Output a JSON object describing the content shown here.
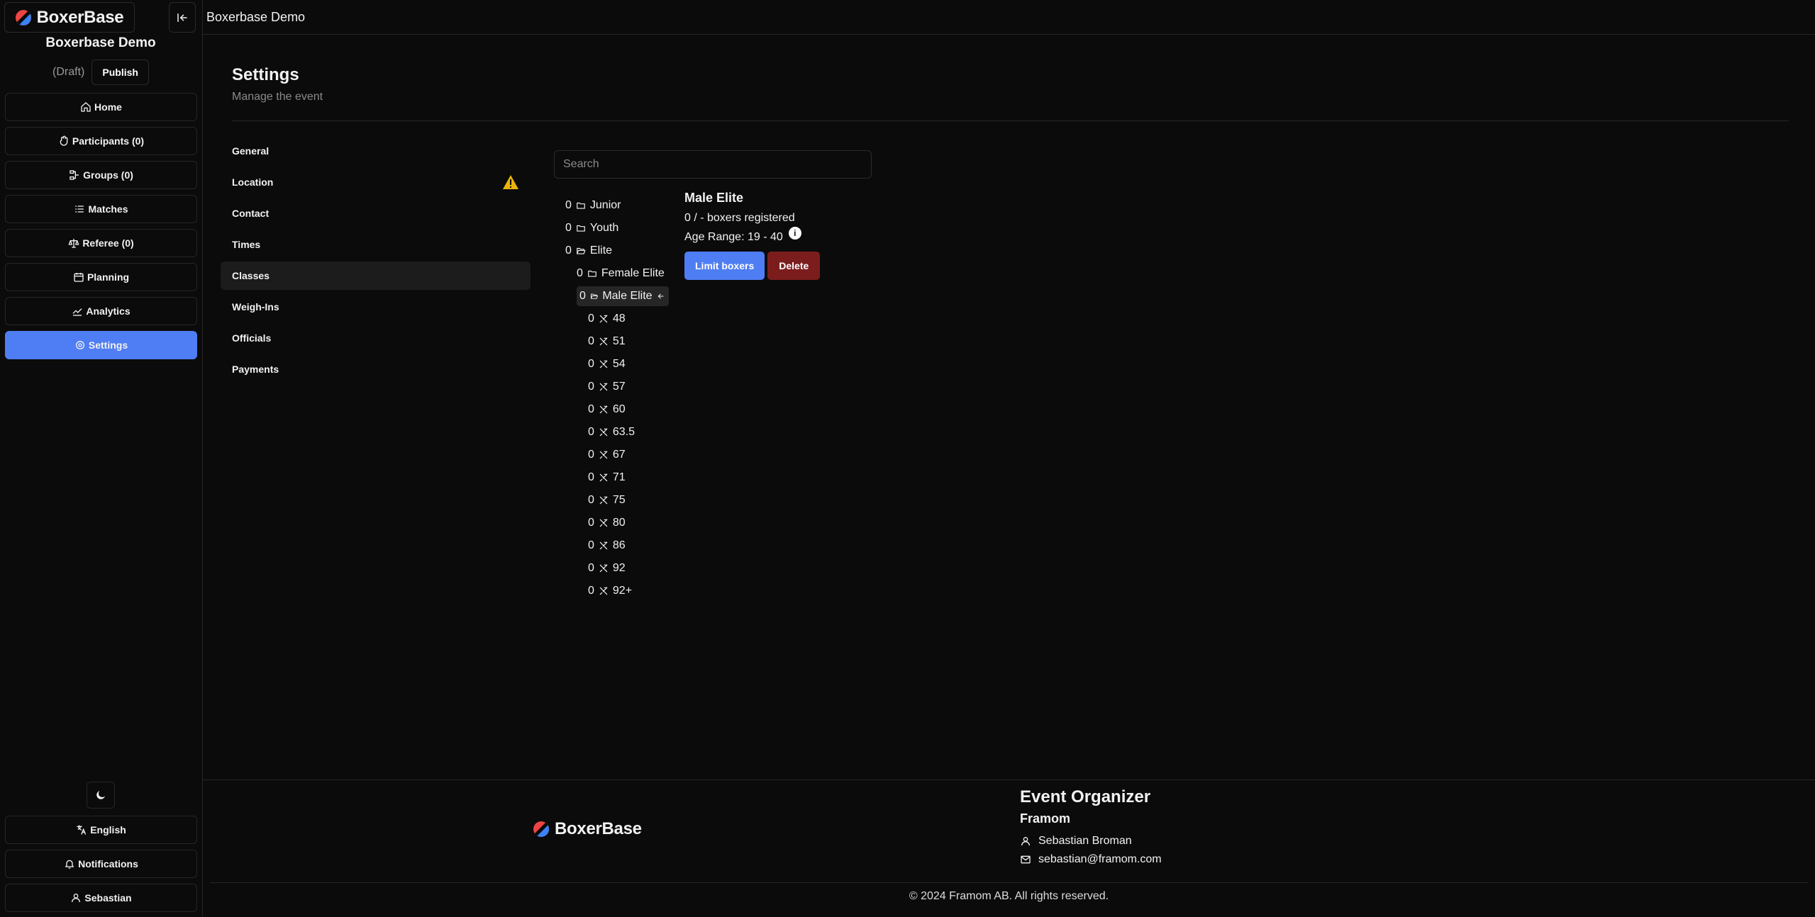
{
  "brand": {
    "name": "BoxerBase"
  },
  "sidebar": {
    "event_title": "Boxerbase Demo",
    "draft_label": "(Draft)",
    "publish_label": "Publish",
    "nav": [
      {
        "label": "Home",
        "icon": "home-icon"
      },
      {
        "label": "Participants (0)",
        "icon": "hand-icon"
      },
      {
        "label": "Groups (0)",
        "icon": "groups-icon"
      },
      {
        "label": "Matches",
        "icon": "list-icon"
      },
      {
        "label": "Referee (0)",
        "icon": "scale-icon"
      },
      {
        "label": "Planning",
        "icon": "calendar-icon"
      },
      {
        "label": "Analytics",
        "icon": "chart-icon"
      },
      {
        "label": "Settings",
        "icon": "gear-icon",
        "active": true
      }
    ],
    "bottom": [
      {
        "label": "English",
        "icon": "language-icon"
      },
      {
        "label": "Notifications",
        "icon": "bell-icon"
      },
      {
        "label": "Sebastian",
        "icon": "user-icon"
      }
    ]
  },
  "topbar": {
    "title": "Boxerbase Demo"
  },
  "settings": {
    "title": "Settings",
    "subtitle": "Manage the event",
    "menu": [
      {
        "label": "General"
      },
      {
        "label": "Location",
        "warning": true
      },
      {
        "label": "Contact"
      },
      {
        "label": "Times"
      },
      {
        "label": "Classes",
        "active": true
      },
      {
        "label": "Weigh-Ins"
      },
      {
        "label": "Officials"
      },
      {
        "label": "Payments"
      }
    ]
  },
  "classes": {
    "search_placeholder": "Search",
    "tree": {
      "junior": {
        "count": "0",
        "label": "Junior"
      },
      "youth": {
        "count": "0",
        "label": "Youth"
      },
      "elite": {
        "count": "0",
        "label": "Elite"
      },
      "female_elite": {
        "count": "0",
        "label": "Female Elite"
      },
      "male_elite": {
        "count": "0",
        "label": "Male Elite"
      },
      "weights": [
        {
          "count": "0",
          "label": "48"
        },
        {
          "count": "0",
          "label": "51"
        },
        {
          "count": "0",
          "label": "54"
        },
        {
          "count": "0",
          "label": "57"
        },
        {
          "count": "0",
          "label": "60"
        },
        {
          "count": "0",
          "label": "63.5"
        },
        {
          "count": "0",
          "label": "67"
        },
        {
          "count": "0",
          "label": "71"
        },
        {
          "count": "0",
          "label": "75"
        },
        {
          "count": "0",
          "label": "80"
        },
        {
          "count": "0",
          "label": "86"
        },
        {
          "count": "0",
          "label": "92"
        },
        {
          "count": "0",
          "label": "92+"
        }
      ]
    },
    "detail": {
      "title": "Male Elite",
      "registered": "0 / - boxers registered",
      "age_range": "Age Range: 19 - 40",
      "limit_label": "Limit boxers",
      "delete_label": "Delete"
    }
  },
  "footer": {
    "org_heading": "Event Organizer",
    "org_name": "Framom",
    "contact_name": "Sebastian Broman",
    "contact_email": "sebastian@framom.com",
    "copyright": "© 2024 Framom AB. All rights reserved."
  },
  "colors": {
    "accent": "#4f7df3",
    "danger": "#7c1d1d",
    "warning": "#eab308",
    "background": "#0b0b0b"
  }
}
